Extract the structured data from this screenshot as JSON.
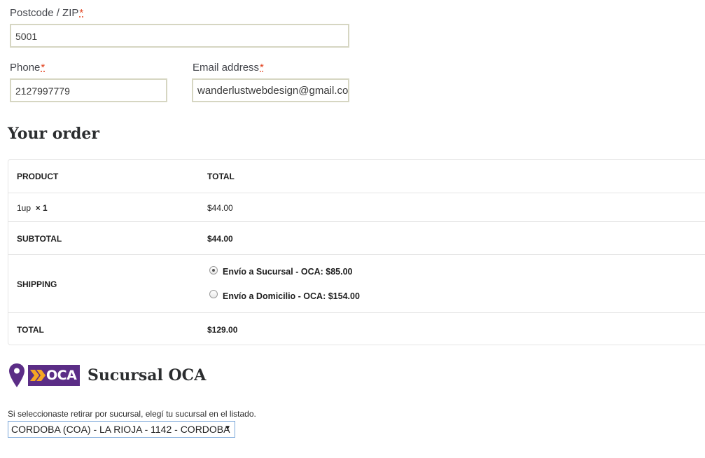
{
  "form": {
    "postcode_label": "Postcode / ZIP",
    "postcode_value": "5001",
    "phone_label": "Phone",
    "phone_value": "2127997779",
    "email_label": "Email address",
    "email_value": "wanderlustwebdesign@gmail.com",
    "required_mark": "*"
  },
  "order": {
    "heading": "Your order",
    "col_product": "PRODUCT",
    "col_total": "TOTAL",
    "item_name": "1up",
    "item_qty": "× 1",
    "item_total": "$44.00",
    "subtotal_label": "SUBTOTAL",
    "subtotal_value": "$44.00",
    "shipping_label": "SHIPPING",
    "shipping_options": [
      {
        "name": "Envío a Sucursal - OCA:",
        "price": "$85.00",
        "selected": true
      },
      {
        "name": "Envío a Domicilio - OCA:",
        "price": "$154.00",
        "selected": false
      }
    ],
    "total_label": "TOTAL",
    "total_value": "$129.00"
  },
  "oca": {
    "logo_text": "OCA",
    "heading": "Sucursal OCA",
    "help_text": "Si seleccionaste retirar por sucursal, elegí tu sucursal en el listado.",
    "selected_branch": "CORDOBA (COA) - LA RIOJA - 1142 - CORDOBA",
    "brand_color": "#5b2d86",
    "accent_color": "#f5a623"
  }
}
